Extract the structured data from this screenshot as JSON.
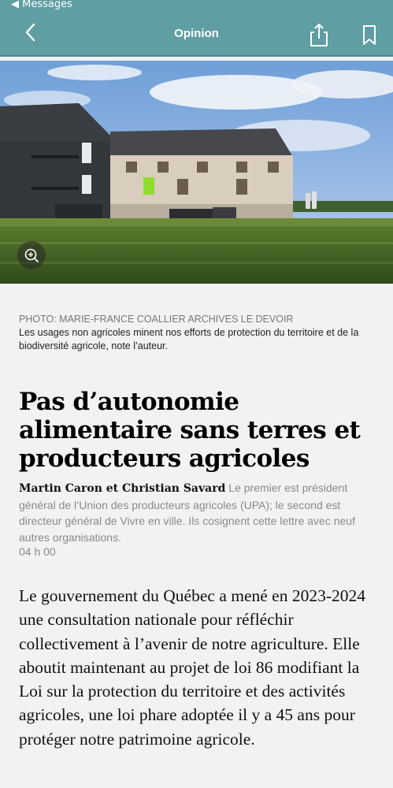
{
  "status_bar": {
    "back_label": "◀ Messages"
  },
  "navbar": {
    "title": "Opinion"
  },
  "photo": {
    "credit": "PHOTO: MARIE-FRANCE COALLIER ARCHIVES LE DEVOIR",
    "caption": "Les usages non agricoles minent nos efforts de protection du territoire et de la biodiversité agricole, note l’auteur."
  },
  "article": {
    "headline": "Pas d’autonomie alimentaire sans terres et producteurs agricoles",
    "authors": "Martin Caron et Christian Savard",
    "author_bio": "Le premier est président général de l’Union des producteurs agricoles (UPA); le second est directeur général de Vivre en ville. Ils cosignent cette lettre avec neuf autres organisations.",
    "time": "04 h 00",
    "body": "Le gouvernement du Québec a mené en 2023-2024 une consultation nationale pour réfléchir collectivement à l’avenir de notre agriculture. Elle aboutit maintenant au projet de loi 86 modifiant la Loi sur la protection du territoire et des activités agricoles, une loi phare adoptée il y a 45 ans pour protéger notre patrimoine agricole."
  },
  "icons": {
    "back": "chevron-left-icon",
    "share": "share-icon",
    "bookmark": "bookmark-icon",
    "zoom": "zoom-in-icon"
  },
  "colors": {
    "navbar": "#5f9ea3",
    "background": "#f2f2f2"
  }
}
